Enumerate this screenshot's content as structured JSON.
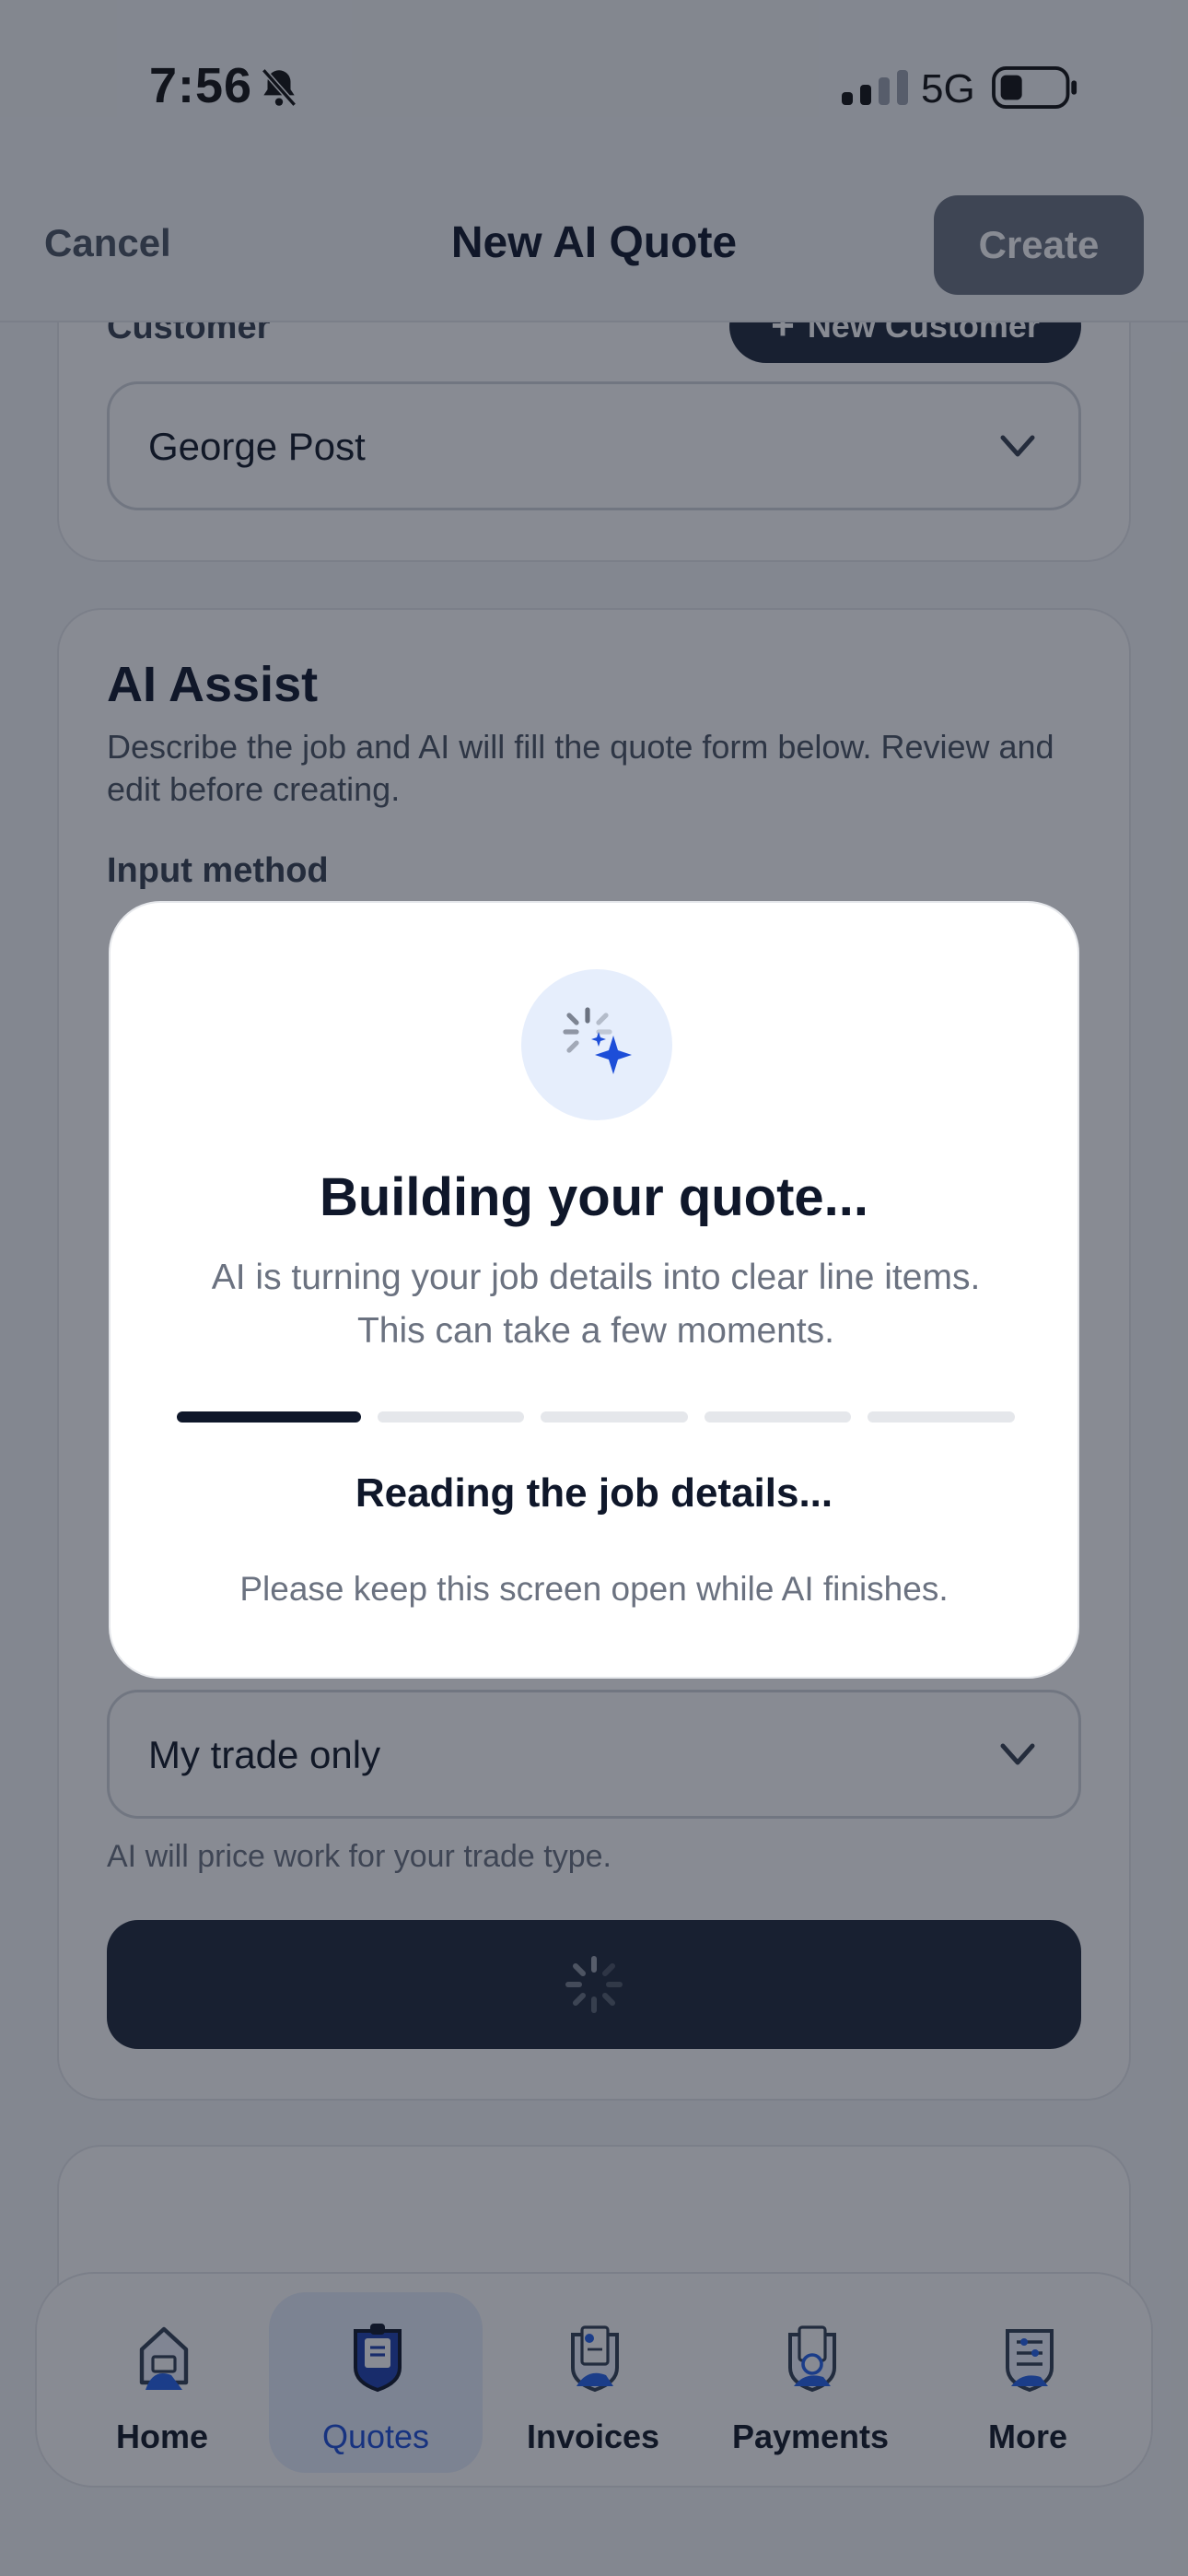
{
  "status_bar": {
    "time": "7:56",
    "network": "5G"
  },
  "header": {
    "cancel_label": "Cancel",
    "title": "New AI Quote",
    "create_label": "Create"
  },
  "customer_section": {
    "label": "Customer",
    "new_customer_label": "New Customer",
    "selected_customer": "George Post"
  },
  "ai_assist": {
    "title": "AI Assist",
    "description": "Describe the job and AI will fill the quote form below. Review and edit before creating.",
    "input_method_label": "Input method",
    "scope_selected": "My trade only",
    "scope_helper": "AI will price work for your trade type."
  },
  "modal": {
    "title": "Building your quote...",
    "body": "AI is turning your job details into clear line items. This can take a few moments.",
    "step_text": "Reading the job details...",
    "note": "Please keep this screen open while AI finishes.",
    "progress_completed": 1,
    "progress_total": 5
  },
  "tabs": [
    {
      "label": "Home",
      "icon": "home-icon"
    },
    {
      "label": "Quotes",
      "icon": "quotes-icon"
    },
    {
      "label": "Invoices",
      "icon": "invoices-icon"
    },
    {
      "label": "Payments",
      "icon": "payments-icon"
    },
    {
      "label": "More",
      "icon": "more-icon"
    }
  ],
  "active_tab": "Quotes",
  "colors": {
    "accent": "#1d4ed8",
    "dark": "#0f172a",
    "accent_light": "#e6eefc"
  }
}
